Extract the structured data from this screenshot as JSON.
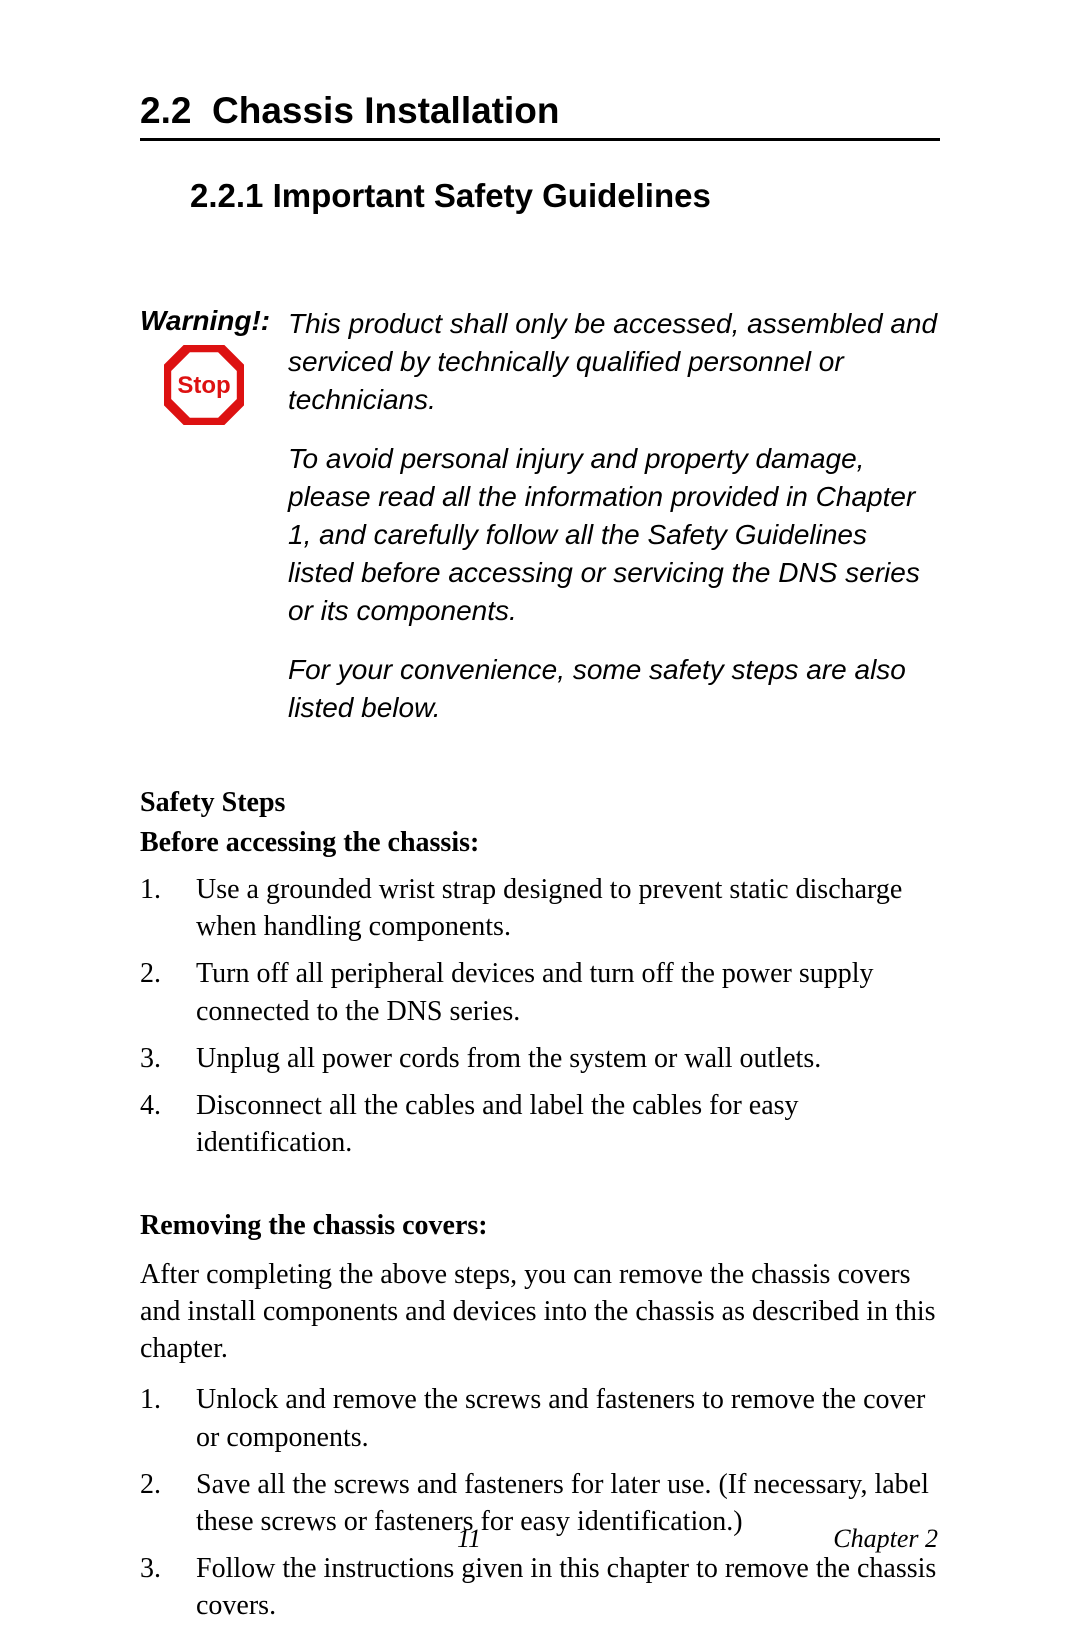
{
  "section": {
    "number": "2.2",
    "title": "Chassis Installation"
  },
  "subsection": {
    "number": "2.2.1",
    "title": "Important Safety Guidelines"
  },
  "warning": {
    "label": "Warning!:",
    "icon_text": "Stop",
    "paragraphs": [
      "This product shall only be accessed, assembled and serviced by technically qualified personnel or technicians.",
      "To avoid personal injury and property damage, please read all the information provided in Chapter 1, and carefully follow all the Safety Guidelines listed before accessing or servicing the DNS series or its components.",
      "For your convenience, some safety steps are also listed below."
    ]
  },
  "safety_steps_heading": "Safety Steps",
  "before_heading": "Before accessing the chassis:",
  "before_list": [
    "Use a grounded wrist strap designed to prevent static discharge when handling components.",
    "Turn off all peripheral devices and turn off the power supply connected to the DNS series.",
    "Unplug all power cords from the system or wall outlets.",
    "Disconnect all the cables and label the cables for easy identification."
  ],
  "removing_heading": "Removing the chassis covers:",
  "removing_intro": "After completing the above steps, you can remove the chassis covers and install components and devices into the chassis as described in this chapter.",
  "removing_list": [
    "Unlock and remove the screws and fasteners to remove the cover or components.",
    "Save all the screws and fasteners for later use. (If necessary, label these screws or fasteners for easy identification.)",
    "Follow the instructions given in this chapter to remove the chassis covers."
  ],
  "footer": {
    "page_number": "11",
    "chapter": "Chapter 2"
  }
}
